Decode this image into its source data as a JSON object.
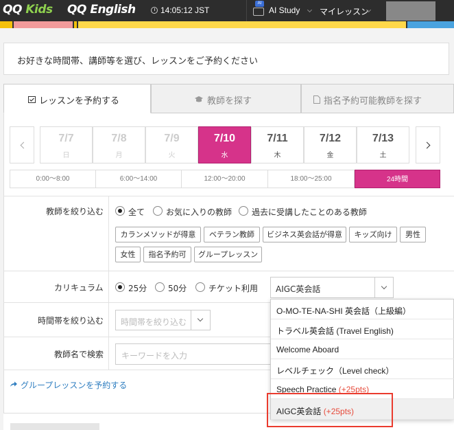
{
  "header": {
    "logo_kids": "QQ Kids",
    "logo_english": "QQ English",
    "clock": "14:05:12 JST",
    "ai_badge": "AI",
    "nav_ai_study": "AI Study",
    "nav_my_lesson": "マイレッスン"
  },
  "instruction": "お好きな時間帯、講師等を選び、レッスンをご予約ください",
  "tabs": [
    {
      "label": "レッスンを予約する",
      "active": true
    },
    {
      "label": "教師を探す",
      "active": false
    },
    {
      "label": "指名予約可能教師を探す",
      "active": false
    }
  ],
  "dates": [
    {
      "num": "7/7",
      "day": "日",
      "state": "past"
    },
    {
      "num": "7/8",
      "day": "月",
      "state": "past"
    },
    {
      "num": "7/9",
      "day": "火",
      "state": "past"
    },
    {
      "num": "7/10",
      "day": "水",
      "state": "selected"
    },
    {
      "num": "7/11",
      "day": "木",
      "state": "normal"
    },
    {
      "num": "7/12",
      "day": "金",
      "state": "normal"
    },
    {
      "num": "7/13",
      "day": "土",
      "state": "normal"
    }
  ],
  "time_ranges": [
    "0:00〜8:00",
    "6:00〜14:00",
    "12:00〜20:00",
    "18:00〜25:00",
    "24時間"
  ],
  "selected_time_range": "24時間",
  "filters": {
    "teacher_label": "教師を絞り込む",
    "teacher_options": [
      "全て",
      "お気に入りの教師",
      "過去に受講したことのある教師"
    ],
    "teacher_selected": "全て",
    "chips_row1": [
      "カランメソッドが得意",
      "ベテラン教師",
      "ビジネス英会話が得意",
      "キッズ向け",
      "男性"
    ],
    "chips_row2": [
      "女性",
      "指名予約可",
      "グループレッスン"
    ],
    "curriculum_label": "カリキュラム",
    "curriculum_options": [
      "25分",
      "50分",
      "チケット利用"
    ],
    "curriculum_selected": "25分",
    "curriculum_value": "AIGC英会話",
    "time_label": "時間帯を絞り込む",
    "time_placeholder": "時間帯を絞り込む",
    "name_label": "教師名で検索",
    "name_placeholder": "キーワードを入力"
  },
  "group_link": "グループレッスンを予約する",
  "dropdown_items": [
    {
      "text": "O-MO-TE-NA-SHI 英会話（上級編）",
      "points": ""
    },
    {
      "text": "トラベル英会話 (Travel English)",
      "points": ""
    },
    {
      "text": "Welcome Aboard",
      "points": ""
    },
    {
      "text": "レベルチェック（Level check）",
      "points": ""
    },
    {
      "text": "Speech Practice ",
      "points": "(+25pts)"
    },
    {
      "text": "AIGC英会話 ",
      "points": "(+25pts)"
    }
  ],
  "colors": {
    "accent_pink": "#d6338a",
    "highlight_red": "#ea3b2e",
    "link_blue": "#2f7ec0",
    "points_red": "#e64a3a"
  }
}
